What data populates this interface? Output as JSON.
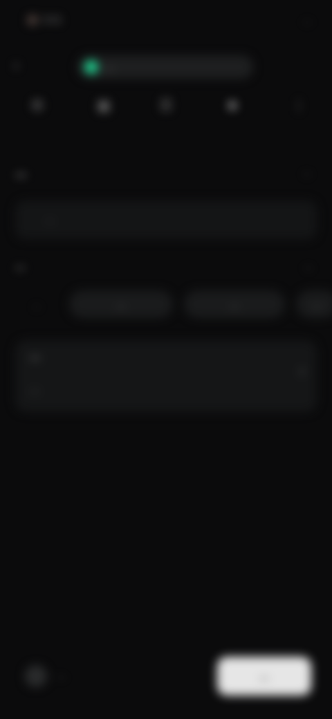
{
  "status_bar": {
    "time": "9:41",
    "right": "..."
  },
  "top_bar": {
    "back_icon": "back-arrow-icon",
    "address": "...",
    "accent": "#1ecf8e"
  },
  "icon_row": [
    {
      "icon": "tool-icon",
      "label": ""
    },
    {
      "icon": "bookmark-icon",
      "label": ""
    },
    {
      "icon": "list-icon",
      "label": ""
    },
    {
      "icon": "star-icon",
      "label": ""
    },
    {
      "icon": "more-icon",
      "label": ""
    }
  ],
  "section": {
    "title": "...",
    "link": "..."
  },
  "url_box": {
    "placeholder": "..."
  },
  "network": {
    "label": "...",
    "value": "..."
  },
  "chips": [
    "...",
    "...",
    "...",
    "..."
  ],
  "card": {
    "title": "...",
    "subtitle": "..."
  },
  "bottom_bar": {
    "selector_label": "...",
    "cta_label": "..."
  }
}
